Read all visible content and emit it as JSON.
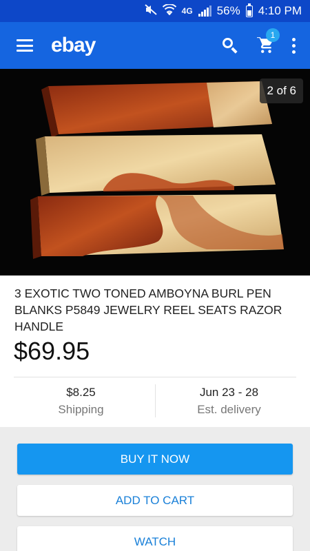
{
  "status_bar": {
    "mute_icon": "mute-icon",
    "wifi_icon": "wifi-icon",
    "network": "4G",
    "battery": "56%",
    "time": "4:10 PM"
  },
  "app_bar": {
    "logo": "ebay",
    "cart_count": "1",
    "colors": {
      "bar": "#1565e0",
      "status": "#0d47c8",
      "badge": "#28a8f0"
    }
  },
  "image": {
    "counter": "2 of 6"
  },
  "listing": {
    "title": "3 EXOTIC TWO TONED AMBOYNA BURL PEN BLANKS P5849 JEWELRY REEL SEATS RAZOR HANDLE",
    "price": "$69.95",
    "shipping_value": "$8.25",
    "shipping_label": "Shipping",
    "delivery_value": "Jun 23 - 28",
    "delivery_label": "Est. delivery"
  },
  "actions": {
    "buy_now": "BUY IT NOW",
    "add_to_cart": "ADD TO CART",
    "watch": "WATCH",
    "primary_color": "#1596f0"
  }
}
